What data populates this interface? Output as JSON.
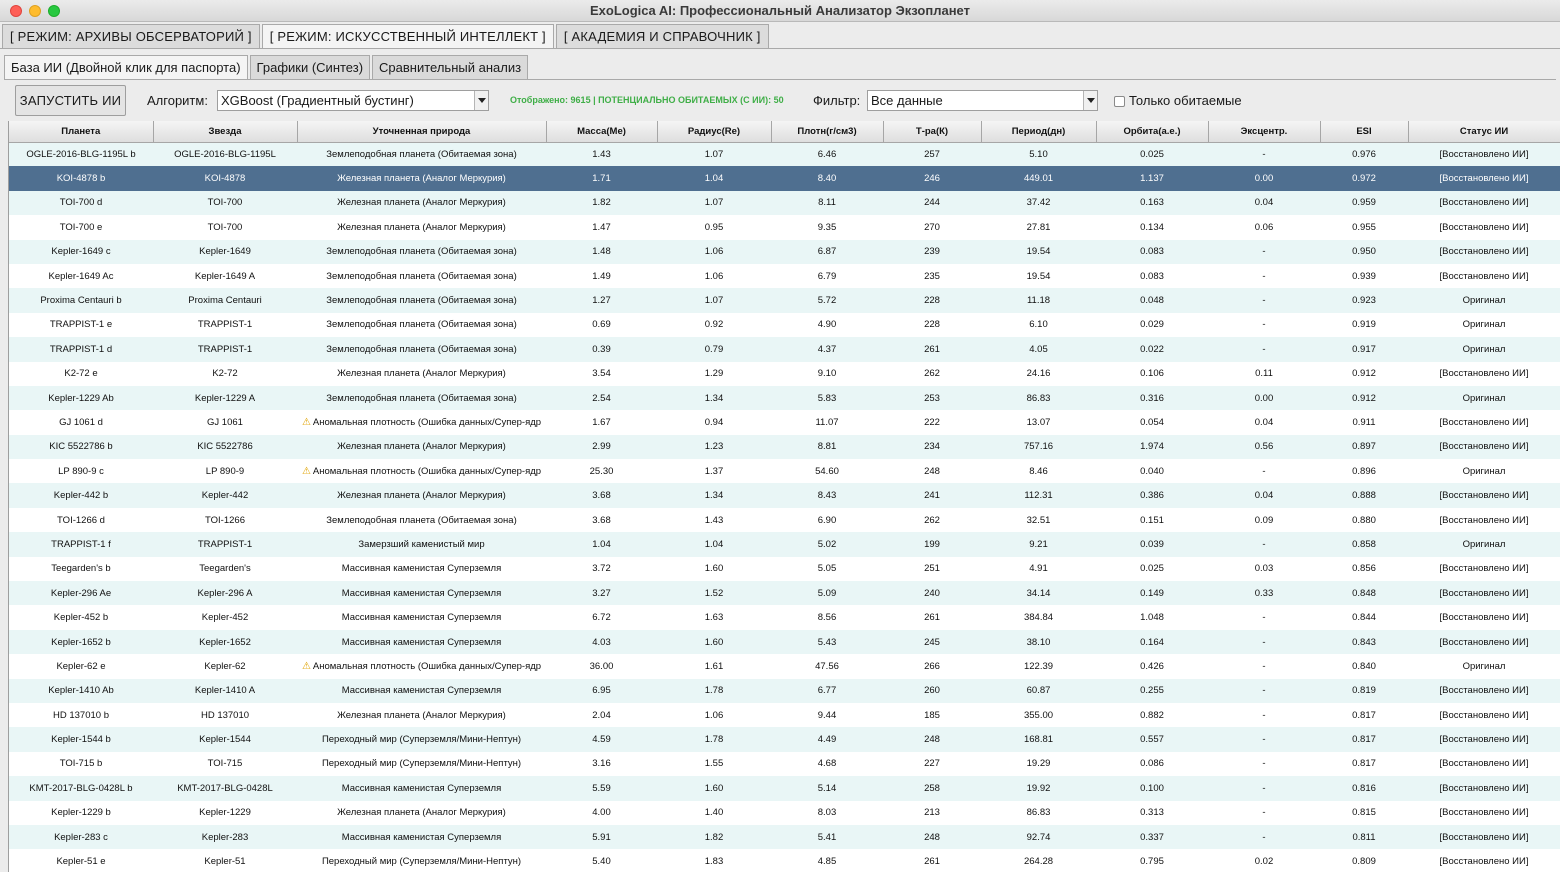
{
  "window": {
    "title": "ExoLogica AI: Профессиональный Анализатор Экзопланет"
  },
  "mode_tabs": [
    {
      "label": "[ РЕЖИМ: АРХИВЫ ОБСЕРВАТОРИЙ ]",
      "active": false
    },
    {
      "label": "[ РЕЖИМ: ИСКУССТВЕННЫЙ ИНТЕЛЛЕКТ ]",
      "active": true
    },
    {
      "label": "[ АКАДЕМИЯ И СПРАВОЧНИК ]",
      "active": false
    }
  ],
  "sub_tabs": [
    {
      "label": "База ИИ (Двойной клик для паспорта)",
      "active": true
    },
    {
      "label": "Графики (Синтез)",
      "active": false
    },
    {
      "label": "Сравнительный анализ",
      "active": false
    }
  ],
  "toolbar": {
    "run_label": "ЗАПУСТИТЬ ИИ",
    "algorithm_label": "Алгоритм:",
    "algorithm_value": "XGBoost (Градиентный бустинг)",
    "status": "Отображено: 9615 | ПОТЕНЦИАЛЬНО ОБИТАЕМЫХ (С ИИ): 50",
    "filter_label": "Фильтр:",
    "filter_value": "Все данные",
    "habitable_only_label": "Только обитаемые",
    "habitable_only_checked": false
  },
  "colors": {
    "status_green": "#3fae47",
    "selection": "#4f6f90",
    "row_alt": "#e9f6f6",
    "warning": "#e0a300"
  },
  "table": {
    "columns": [
      "Планета",
      "Звезда",
      "Уточненная природа",
      "Масса(Me)",
      "Радиус(Re)",
      "Плотн(г/см3)",
      "Т-ра(К)",
      "Период(дн)",
      "Орбита(а.е.)",
      "Эксцентр.",
      "ESI",
      "Статус ИИ"
    ],
    "selected_index": 1,
    "rows": [
      [
        "OGLE-2016-BLG-1195L b",
        "OGLE-2016-BLG-1195L",
        "Землеподобная планета (Обитаемая зона)",
        "1.43",
        "1.07",
        "6.46",
        "257",
        "5.10",
        "0.025",
        "-",
        "0.976",
        "[Восстановлено ИИ]"
      ],
      [
        "KOI-4878 b",
        "KOI-4878",
        "Железная планета (Аналог Меркурия)",
        "1.71",
        "1.04",
        "8.40",
        "246",
        "449.01",
        "1.137",
        "0.00",
        "0.972",
        "[Восстановлено ИИ]"
      ],
      [
        "TOI-700 d",
        "TOI-700",
        "Железная планета (Аналог Меркурия)",
        "1.82",
        "1.07",
        "8.11",
        "244",
        "37.42",
        "0.163",
        "0.04",
        "0.959",
        "[Восстановлено ИИ]"
      ],
      [
        "TOI-700 e",
        "TOI-700",
        "Железная планета (Аналог Меркурия)",
        "1.47",
        "0.95",
        "9.35",
        "270",
        "27.81",
        "0.134",
        "0.06",
        "0.955",
        "[Восстановлено ИИ]"
      ],
      [
        "Kepler-1649 c",
        "Kepler-1649",
        "Землеподобная планета (Обитаемая зона)",
        "1.48",
        "1.06",
        "6.87",
        "239",
        "19.54",
        "0.083",
        "-",
        "0.950",
        "[Восстановлено ИИ]"
      ],
      [
        "Kepler-1649 Ac",
        "Kepler-1649 A",
        "Землеподобная планета (Обитаемая зона)",
        "1.49",
        "1.06",
        "6.79",
        "235",
        "19.54",
        "0.083",
        "-",
        "0.939",
        "[Восстановлено ИИ]"
      ],
      [
        "Proxima Centauri b",
        "Proxima Centauri",
        "Землеподобная планета (Обитаемая зона)",
        "1.27",
        "1.07",
        "5.72",
        "228",
        "11.18",
        "0.048",
        "-",
        "0.923",
        "Оригинал"
      ],
      [
        "TRAPPIST-1 e",
        "TRAPPIST-1",
        "Землеподобная планета (Обитаемая зона)",
        "0.69",
        "0.92",
        "4.90",
        "228",
        "6.10",
        "0.029",
        "-",
        "0.919",
        "Оригинал"
      ],
      [
        "TRAPPIST-1 d",
        "TRAPPIST-1",
        "Землеподобная планета (Обитаемая зона)",
        "0.39",
        "0.79",
        "4.37",
        "261",
        "4.05",
        "0.022",
        "-",
        "0.917",
        "Оригинал"
      ],
      [
        "K2-72 e",
        "K2-72",
        "Железная планета (Аналог Меркурия)",
        "3.54",
        "1.29",
        "9.10",
        "262",
        "24.16",
        "0.106",
        "0.11",
        "0.912",
        "[Восстановлено ИИ]"
      ],
      [
        "Kepler-1229 Ab",
        "Kepler-1229 A",
        "Землеподобная планета (Обитаемая зона)",
        "2.54",
        "1.34",
        "5.83",
        "253",
        "86.83",
        "0.316",
        "0.00",
        "0.912",
        "Оригинал"
      ],
      [
        "GJ 1061 d",
        "GJ 1061",
        "⚠ Аномальная плотность (Ошибка данных/Супер-ядр",
        "1.67",
        "0.94",
        "11.07",
        "222",
        "13.07",
        "0.054",
        "0.04",
        "0.911",
        "[Восстановлено ИИ]"
      ],
      [
        "KIC 5522786 b",
        "KIC 5522786",
        "Железная планета (Аналог Меркурия)",
        "2.99",
        "1.23",
        "8.81",
        "234",
        "757.16",
        "1.974",
        "0.56",
        "0.897",
        "[Восстановлено ИИ]"
      ],
      [
        "LP 890-9 c",
        "LP 890-9",
        "⚠ Аномальная плотность (Ошибка данных/Супер-ядр",
        "25.30",
        "1.37",
        "54.60",
        "248",
        "8.46",
        "0.040",
        "-",
        "0.896",
        "Оригинал"
      ],
      [
        "Kepler-442 b",
        "Kepler-442",
        "Железная планета (Аналог Меркурия)",
        "3.68",
        "1.34",
        "8.43",
        "241",
        "112.31",
        "0.386",
        "0.04",
        "0.888",
        "[Восстановлено ИИ]"
      ],
      [
        "TOI-1266 d",
        "TOI-1266",
        "Землеподобная планета (Обитаемая зона)",
        "3.68",
        "1.43",
        "6.90",
        "262",
        "32.51",
        "0.151",
        "0.09",
        "0.880",
        "[Восстановлено ИИ]"
      ],
      [
        "TRAPPIST-1 f",
        "TRAPPIST-1",
        "Замерзший каменистый мир",
        "1.04",
        "1.04",
        "5.02",
        "199",
        "9.21",
        "0.039",
        "-",
        "0.858",
        "Оригинал"
      ],
      [
        "Teegarden's b",
        "Teegarden's",
        "Массивная каменистая Суперземля",
        "3.72",
        "1.60",
        "5.05",
        "251",
        "4.91",
        "0.025",
        "0.03",
        "0.856",
        "[Восстановлено ИИ]"
      ],
      [
        "Kepler-296 Ae",
        "Kepler-296 A",
        "Массивная каменистая Суперземля",
        "3.27",
        "1.52",
        "5.09",
        "240",
        "34.14",
        "0.149",
        "0.33",
        "0.848",
        "[Восстановлено ИИ]"
      ],
      [
        "Kepler-452 b",
        "Kepler-452",
        "Массивная каменистая Суперземля",
        "6.72",
        "1.63",
        "8.56",
        "261",
        "384.84",
        "1.048",
        "-",
        "0.844",
        "[Восстановлено ИИ]"
      ],
      [
        "Kepler-1652 b",
        "Kepler-1652",
        "Массивная каменистая Суперземля",
        "4.03",
        "1.60",
        "5.43",
        "245",
        "38.10",
        "0.164",
        "-",
        "0.843",
        "[Восстановлено ИИ]"
      ],
      [
        "Kepler-62 e",
        "Kepler-62",
        "⚠ Аномальная плотность (Ошибка данных/Супер-ядр",
        "36.00",
        "1.61",
        "47.56",
        "266",
        "122.39",
        "0.426",
        "-",
        "0.840",
        "Оригинал"
      ],
      [
        "Kepler-1410 Ab",
        "Kepler-1410 A",
        "Массивная каменистая Суперземля",
        "6.95",
        "1.78",
        "6.77",
        "260",
        "60.87",
        "0.255",
        "-",
        "0.819",
        "[Восстановлено ИИ]"
      ],
      [
        "HD 137010 b",
        "HD 137010",
        "Железная планета (Аналог Меркурия)",
        "2.04",
        "1.06",
        "9.44",
        "185",
        "355.00",
        "0.882",
        "-",
        "0.817",
        "[Восстановлено ИИ]"
      ],
      [
        "Kepler-1544 b",
        "Kepler-1544",
        "Переходный мир (Суперземля/Мини-Нептун)",
        "4.59",
        "1.78",
        "4.49",
        "248",
        "168.81",
        "0.557",
        "-",
        "0.817",
        "[Восстановлено ИИ]"
      ],
      [
        "TOI-715 b",
        "TOI-715",
        "Переходный мир (Суперземля/Мини-Нептун)",
        "3.16",
        "1.55",
        "4.68",
        "227",
        "19.29",
        "0.086",
        "-",
        "0.817",
        "[Восстановлено ИИ]"
      ],
      [
        "KMT-2017-BLG-0428L b",
        "KMT-2017-BLG-0428L",
        "Массивная каменистая Суперземля",
        "5.59",
        "1.60",
        "5.14",
        "258",
        "19.92",
        "0.100",
        "-",
        "0.816",
        "[Восстановлено ИИ]"
      ],
      [
        "Kepler-1229 b",
        "Kepler-1229",
        "Железная планета (Аналог Меркурия)",
        "4.00",
        "1.40",
        "8.03",
        "213",
        "86.83",
        "0.313",
        "-",
        "0.815",
        "[Восстановлено ИИ]"
      ],
      [
        "Kepler-283 c",
        "Kepler-283",
        "Массивная каменистая Суперземля",
        "5.91",
        "1.82",
        "5.41",
        "248",
        "92.74",
        "0.337",
        "-",
        "0.811",
        "[Восстановлено ИИ]"
      ],
      [
        "Kepler-51 e",
        "Kepler-51",
        "Переходный мир (Суперземля/Мини-Нептун)",
        "5.40",
        "1.83",
        "4.85",
        "261",
        "264.28",
        "0.795",
        "0.02",
        "0.809",
        "[Восстановлено ИИ]"
      ]
    ]
  }
}
